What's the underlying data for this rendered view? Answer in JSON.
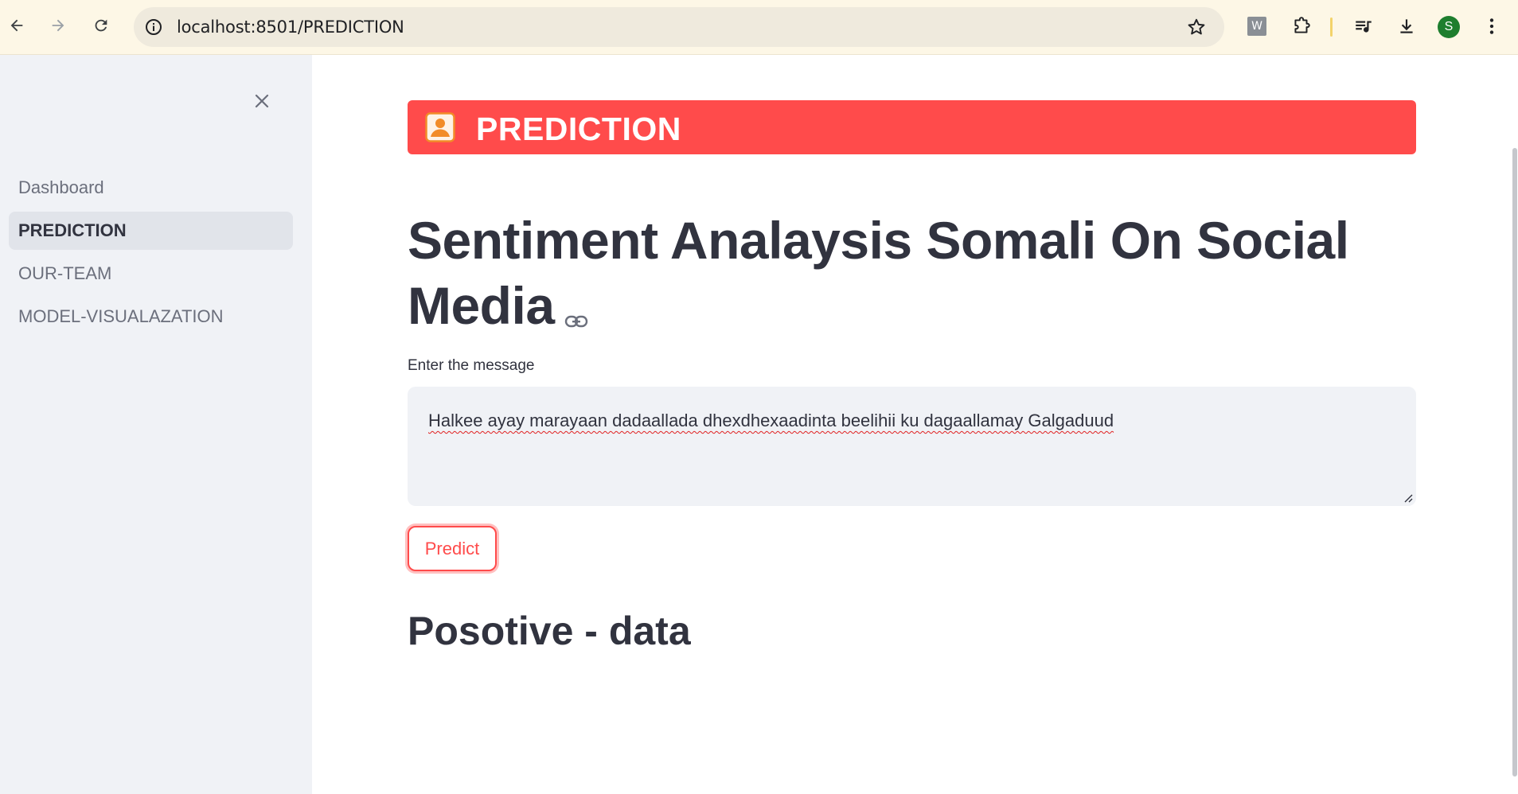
{
  "browser": {
    "url": "localhost:8501/PREDICTION",
    "profile_initial": "S",
    "extension_letter": "W"
  },
  "sidebar": {
    "items": [
      {
        "label": "Dashboard",
        "active": false
      },
      {
        "label": "PREDICTION",
        "active": true
      },
      {
        "label": "OUR-TEAM",
        "active": false
      },
      {
        "label": "MODEL-VISUALAZATION",
        "active": false
      }
    ]
  },
  "main": {
    "banner_title": "PREDICTION",
    "banner_icon": "user-badge-icon",
    "page_title": "Sentiment Analaysis Somali On Social Media",
    "input_label": "Enter the message",
    "input_value": "Halkee ayay marayaan dadaallada dhexdhexaadinta beelihii ku dagaallamay Galgaduud",
    "predict_label": "Predict",
    "result_text": "Posotive - data"
  },
  "colors": {
    "accent": "#ff4b4b",
    "sidebar_bg": "#f0f2f6",
    "text": "#31333f",
    "chrome_bg": "#fdf7e6"
  }
}
